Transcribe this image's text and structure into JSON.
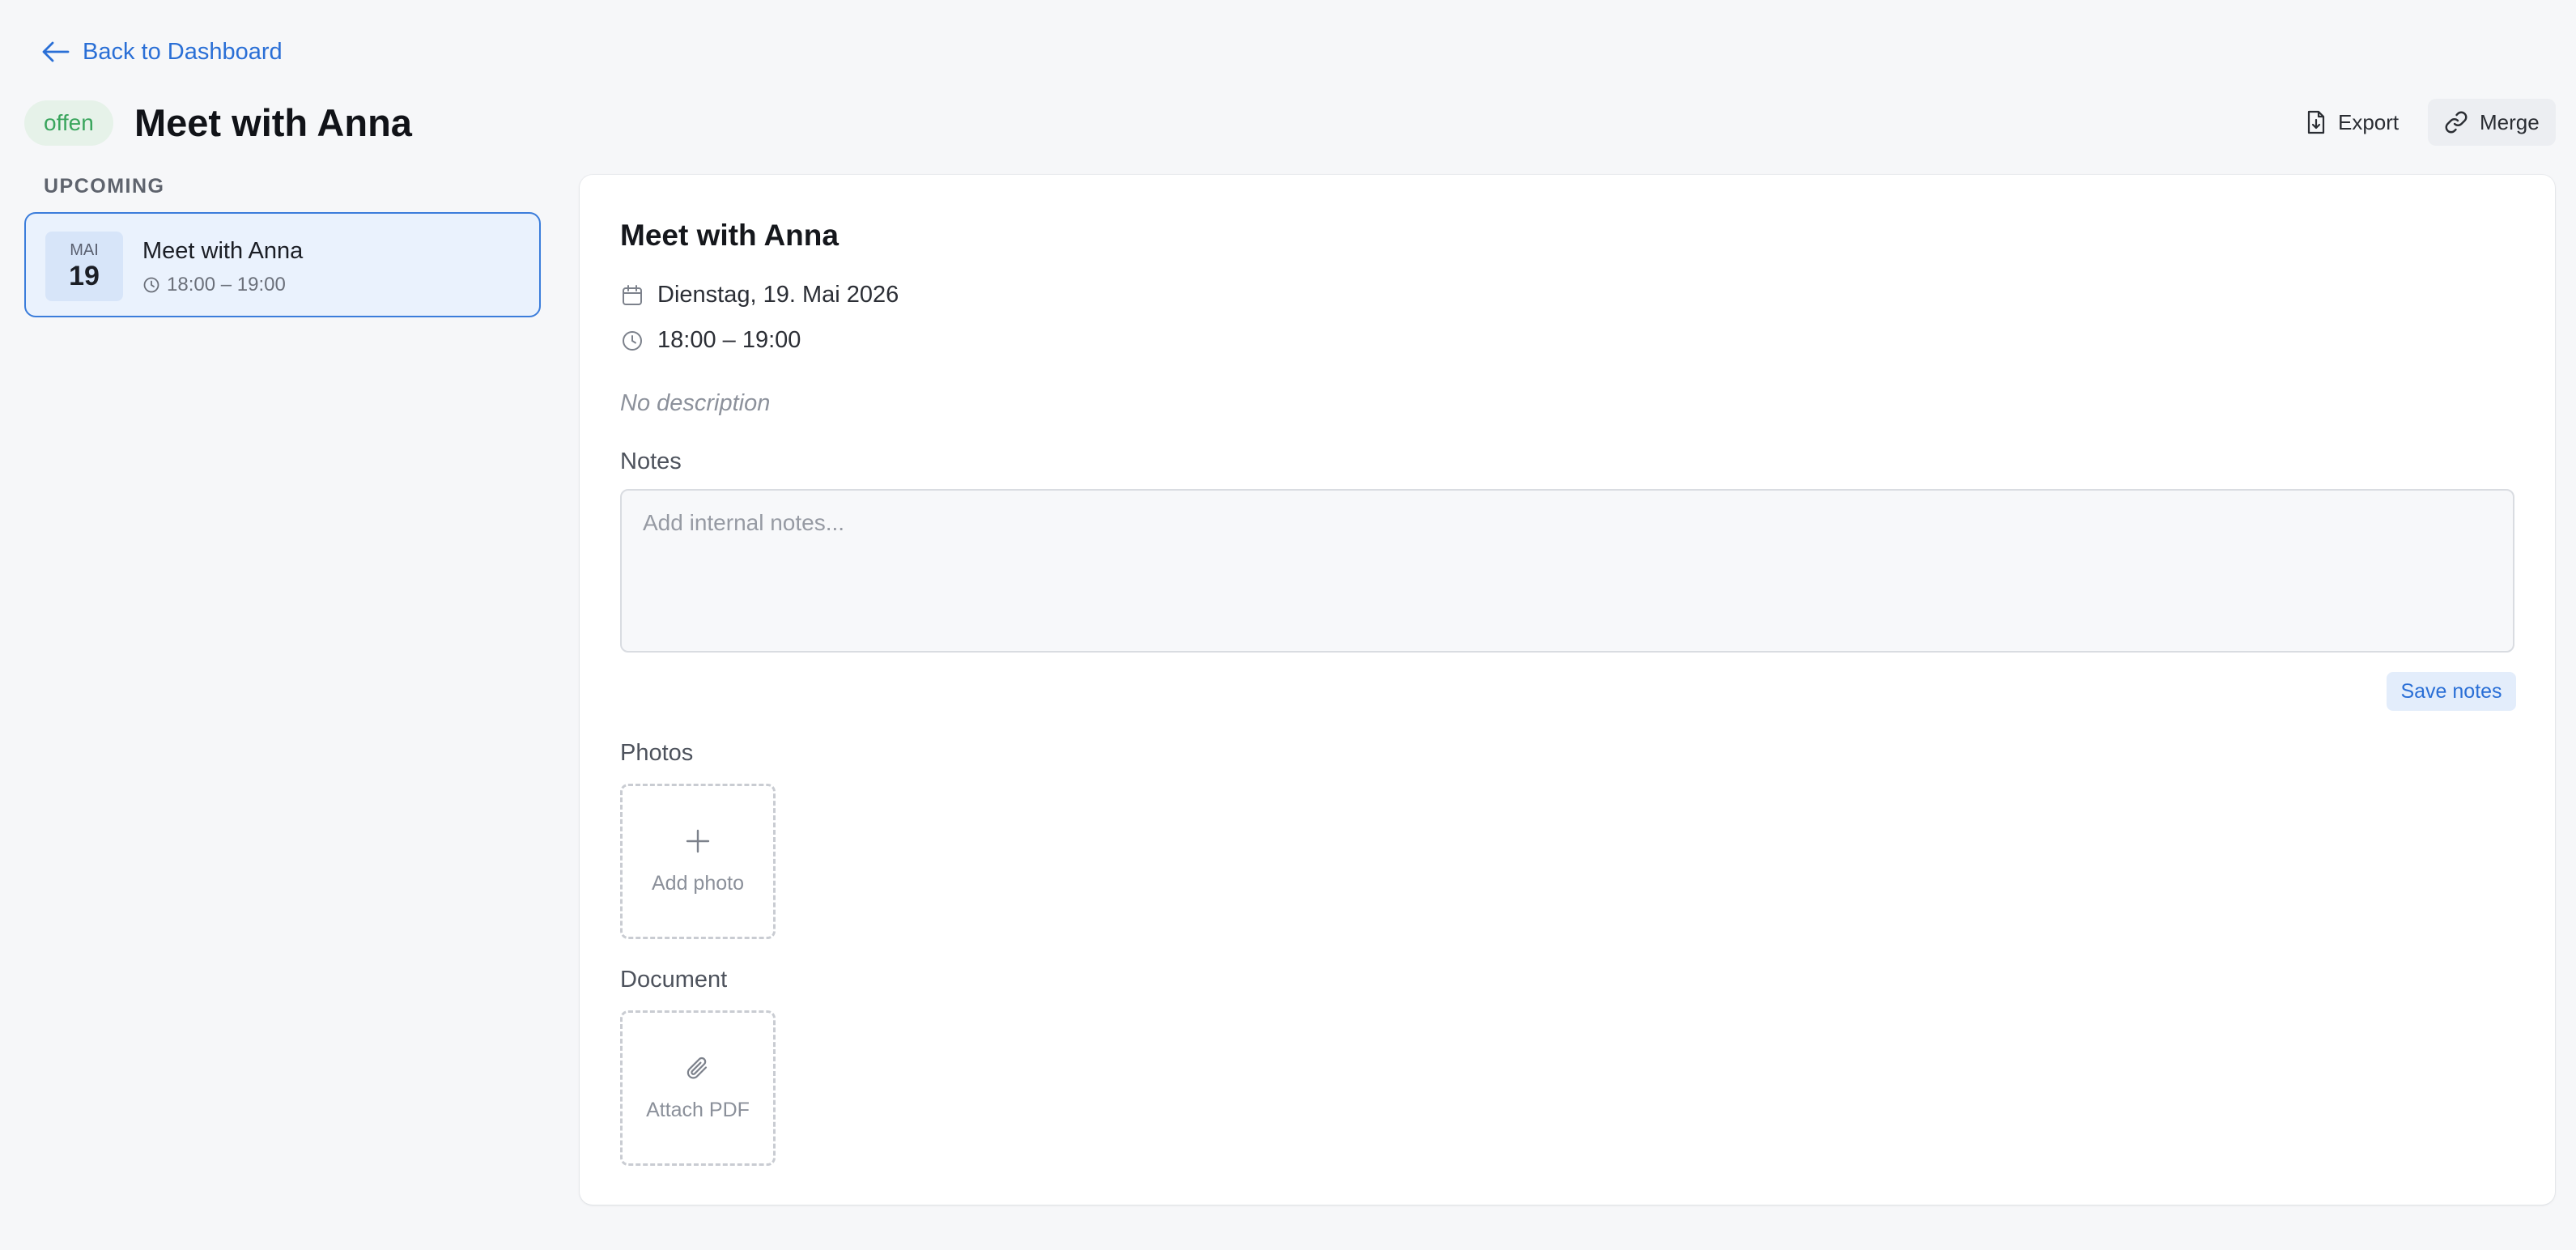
{
  "nav": {
    "back_label": "Back to Dashboard"
  },
  "header": {
    "status": "offen",
    "title": "Meet with Anna",
    "export_label": "Export",
    "merge_label": "Merge"
  },
  "sidebar": {
    "section_label": "UPCOMING",
    "events": [
      {
        "month": "MAI",
        "day": "19",
        "title": "Meet with Anna",
        "time": "18:00 – 19:00",
        "selected": true
      }
    ]
  },
  "detail": {
    "title": "Meet with Anna",
    "date": "Dienstag, 19. Mai 2026",
    "time": "18:00 – 19:00",
    "description": "No description",
    "notes_label": "Notes",
    "notes_value": "",
    "notes_placeholder": "Add internal notes...",
    "save_notes_label": "Save notes",
    "photos_label": "Photos",
    "add_photo_label": "Add photo",
    "document_label": "Document",
    "attach_pdf_label": "Attach PDF"
  },
  "colors": {
    "accent": "#2a6fd6",
    "status_bg": "#e6f2e9",
    "status_text": "#3aa55d",
    "selected_card_bg": "#eaf2fd",
    "selected_card_border": "#3b7ddb",
    "page_bg": "#f6f7f9"
  },
  "icons": [
    "arrow-left-icon",
    "file-export-icon",
    "link-icon",
    "clock-icon",
    "calendar-icon",
    "plus-icon",
    "paperclip-icon"
  ]
}
